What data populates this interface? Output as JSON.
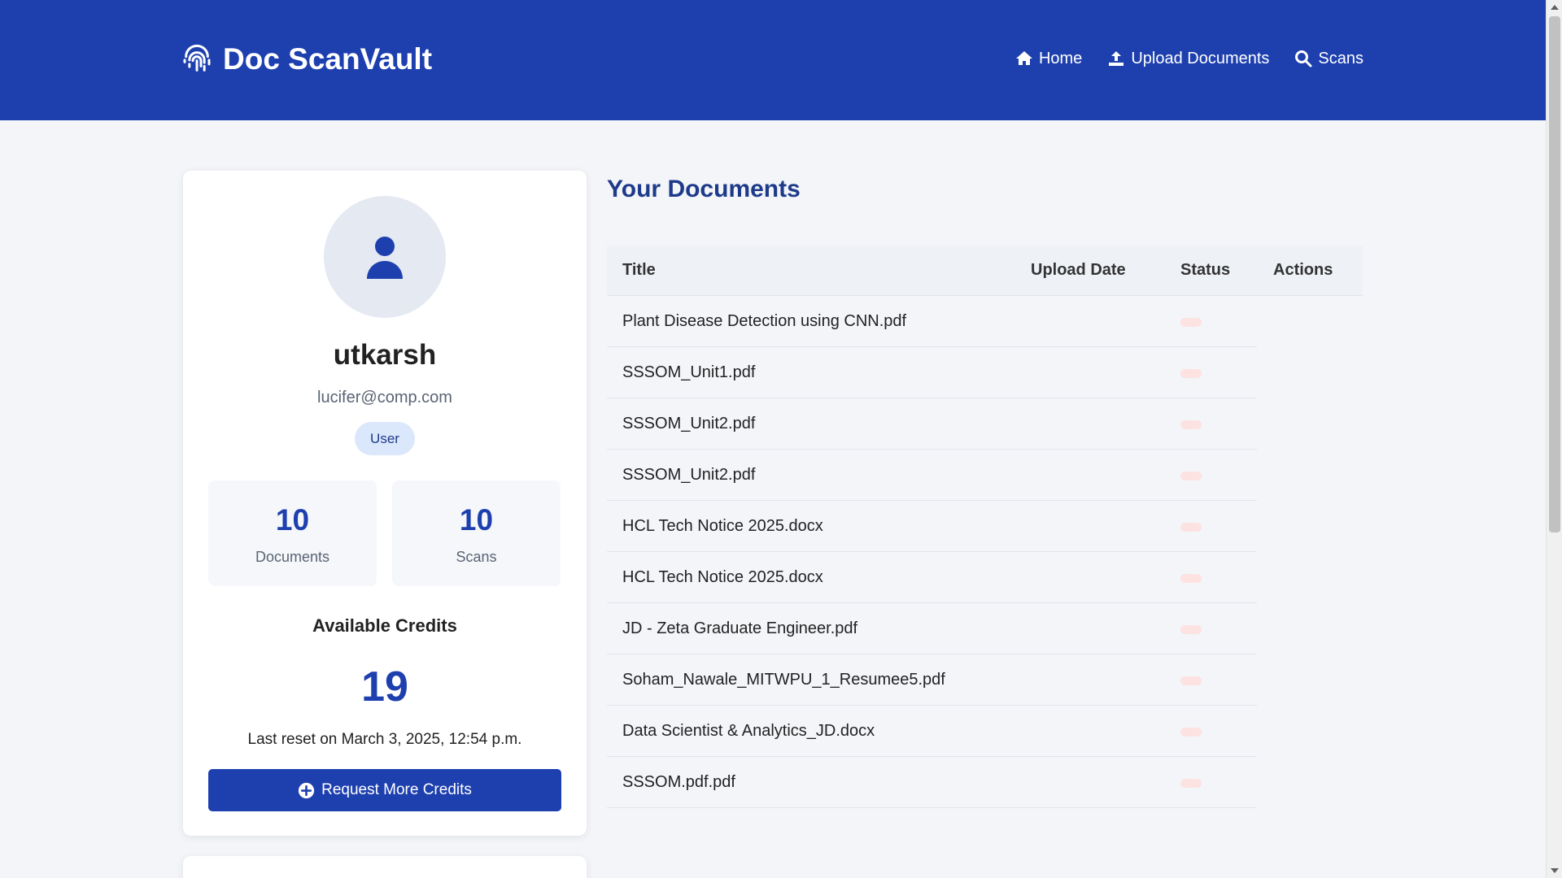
{
  "brand": {
    "name": "Doc ScanVault",
    "icon": "fingerprint-icon"
  },
  "nav": [
    {
      "label": "Home",
      "icon": "home-icon"
    },
    {
      "label": "Upload Documents",
      "icon": "upload-icon"
    },
    {
      "label": "Scans",
      "icon": "search-icon"
    }
  ],
  "profile": {
    "username": "utkarsh",
    "email": "lucifer@comp.com",
    "role": "User",
    "stats": {
      "documents": {
        "value": "10",
        "label": "Documents"
      },
      "scans": {
        "value": "10",
        "label": "Scans"
      }
    },
    "credits": {
      "title": "Available Credits",
      "value": "19",
      "reset_text": "Last reset on March 3, 2025, 12:54 p.m."
    },
    "request_button": "Request More Credits"
  },
  "documents": {
    "heading": "Your Documents",
    "columns": [
      "Title",
      "Upload Date",
      "Status",
      "Actions"
    ],
    "rows": [
      {
        "title": "Plant Disease Detection using CNN.pdf",
        "upload_date": "",
        "status": ""
      },
      {
        "title": "SSSOM_Unit1.pdf",
        "upload_date": "",
        "status": ""
      },
      {
        "title": "SSSOM_Unit2.pdf",
        "upload_date": "",
        "status": ""
      },
      {
        "title": "SSSOM_Unit2.pdf",
        "upload_date": "",
        "status": ""
      },
      {
        "title": "HCL Tech Notice 2025.docx",
        "upload_date": "",
        "status": ""
      },
      {
        "title": "HCL Tech Notice 2025.docx",
        "upload_date": "",
        "status": ""
      },
      {
        "title": "JD - Zeta Graduate Engineer.pdf",
        "upload_date": "",
        "status": ""
      },
      {
        "title": "Soham_Nawale_MITWPU_1_Resumee5.pdf",
        "upload_date": "",
        "status": ""
      },
      {
        "title": "Data Scientist & Analytics_JD.docx",
        "upload_date": "",
        "status": ""
      },
      {
        "title": "SSSOM.pdf.pdf",
        "upload_date": "",
        "status": ""
      }
    ]
  },
  "colors": {
    "primary": "#1e40af",
    "heading": "#1e3a8a",
    "background": "#f3f5f9",
    "status_pill": "#fde2e2",
    "badge_bg": "#dbe7fb"
  }
}
